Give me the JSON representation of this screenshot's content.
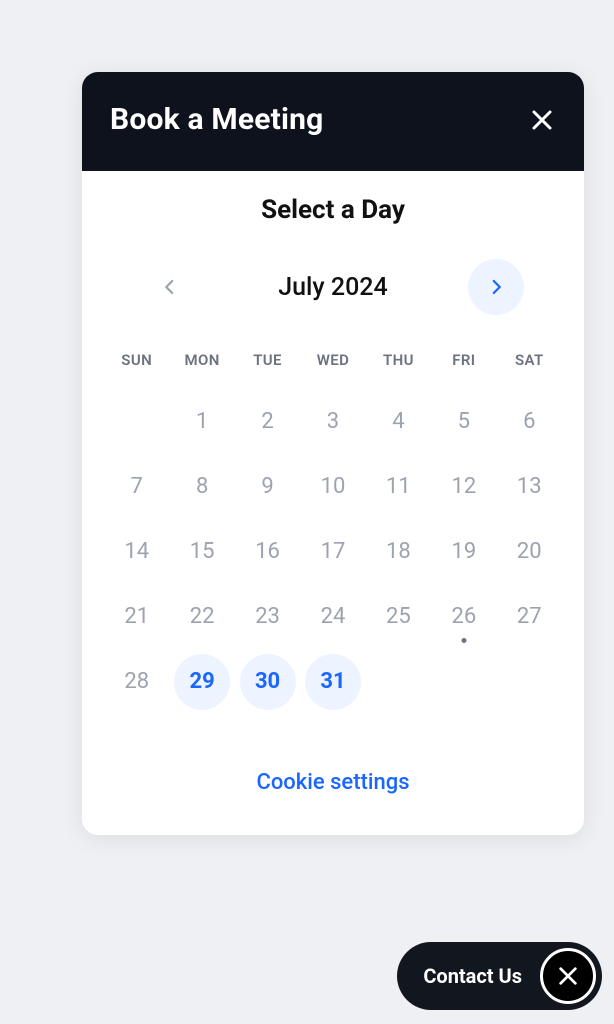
{
  "modal": {
    "title": "Book a Meeting",
    "heading": "Select a Day",
    "month_label": "July 2024",
    "cookie_link": "Cookie settings"
  },
  "calendar": {
    "dow": [
      "SUN",
      "MON",
      "TUE",
      "WED",
      "THU",
      "FRI",
      "SAT"
    ],
    "weeks": [
      [
        {
          "label": "",
          "state": "blank"
        },
        {
          "label": "1",
          "state": "disabled"
        },
        {
          "label": "2",
          "state": "disabled"
        },
        {
          "label": "3",
          "state": "disabled"
        },
        {
          "label": "4",
          "state": "disabled"
        },
        {
          "label": "5",
          "state": "disabled"
        },
        {
          "label": "6",
          "state": "disabled"
        }
      ],
      [
        {
          "label": "7",
          "state": "disabled"
        },
        {
          "label": "8",
          "state": "disabled"
        },
        {
          "label": "9",
          "state": "disabled"
        },
        {
          "label": "10",
          "state": "disabled"
        },
        {
          "label": "11",
          "state": "disabled"
        },
        {
          "label": "12",
          "state": "disabled"
        },
        {
          "label": "13",
          "state": "disabled"
        }
      ],
      [
        {
          "label": "14",
          "state": "disabled"
        },
        {
          "label": "15",
          "state": "disabled"
        },
        {
          "label": "16",
          "state": "disabled"
        },
        {
          "label": "17",
          "state": "disabled"
        },
        {
          "label": "18",
          "state": "disabled"
        },
        {
          "label": "19",
          "state": "disabled"
        },
        {
          "label": "20",
          "state": "disabled"
        }
      ],
      [
        {
          "label": "21",
          "state": "disabled"
        },
        {
          "label": "22",
          "state": "disabled"
        },
        {
          "label": "23",
          "state": "disabled"
        },
        {
          "label": "24",
          "state": "disabled"
        },
        {
          "label": "25",
          "state": "disabled"
        },
        {
          "label": "26",
          "state": "disabled",
          "today": true
        },
        {
          "label": "27",
          "state": "disabled"
        }
      ],
      [
        {
          "label": "28",
          "state": "disabled"
        },
        {
          "label": "29",
          "state": "avail"
        },
        {
          "label": "30",
          "state": "avail"
        },
        {
          "label": "31",
          "state": "avail"
        },
        {
          "label": "",
          "state": "blank"
        },
        {
          "label": "",
          "state": "blank"
        },
        {
          "label": "",
          "state": "blank"
        }
      ]
    ]
  },
  "contact": {
    "label": "Contact Us"
  }
}
